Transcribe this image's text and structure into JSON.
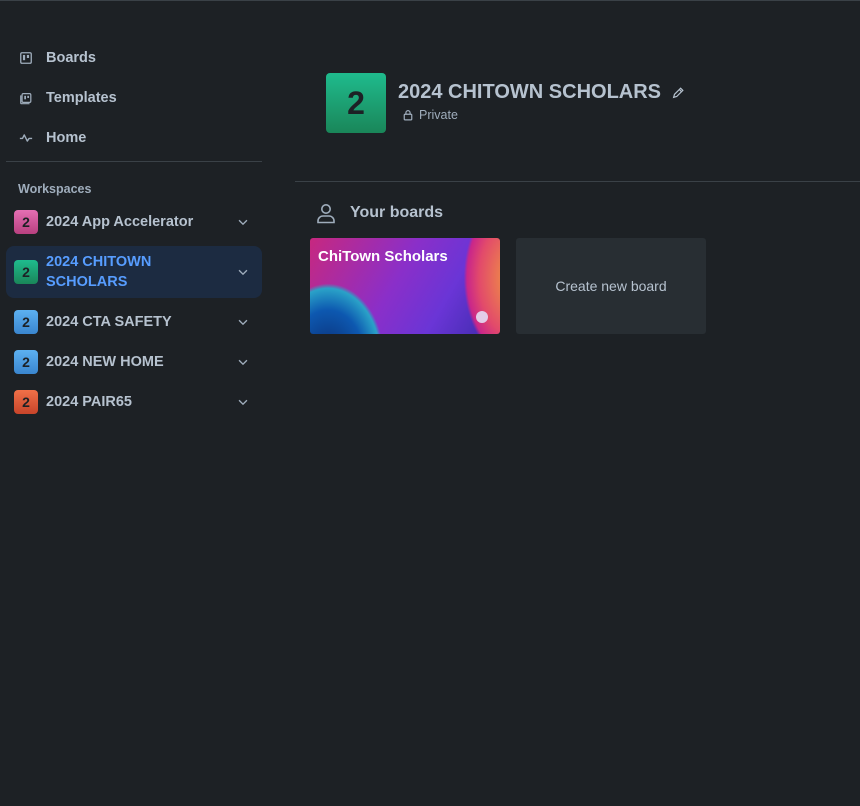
{
  "nav": {
    "boards": "Boards",
    "templates": "Templates",
    "home": "Home"
  },
  "workspaces": {
    "heading": "Workspaces",
    "items": [
      {
        "initial": "2",
        "label": "2024 App Accelerator",
        "color": "#d3569f"
      },
      {
        "initial": "2",
        "label": "2024 CHITOWN SCHOLARS",
        "color": "#1fa971",
        "active": true
      },
      {
        "initial": "2",
        "label": "2024 CTA SAFETY",
        "color": "#4a9fe0"
      },
      {
        "initial": "2",
        "label": "2024 NEW HOME",
        "color": "#4a9fe0"
      },
      {
        "initial": "2",
        "label": "2024 PAIR65",
        "color": "#e05a35"
      }
    ]
  },
  "workspace": {
    "initial": "2",
    "title": "2024 CHITOWN SCHOLARS",
    "visibility": "Private"
  },
  "boards_section": {
    "heading": "Your boards",
    "boards": [
      {
        "title": "ChiTown Scholars"
      }
    ],
    "create_label": "Create new board"
  },
  "colors": {
    "background": "#1d2125",
    "accent": "#579dff",
    "active_bg": "#1c2b41"
  }
}
